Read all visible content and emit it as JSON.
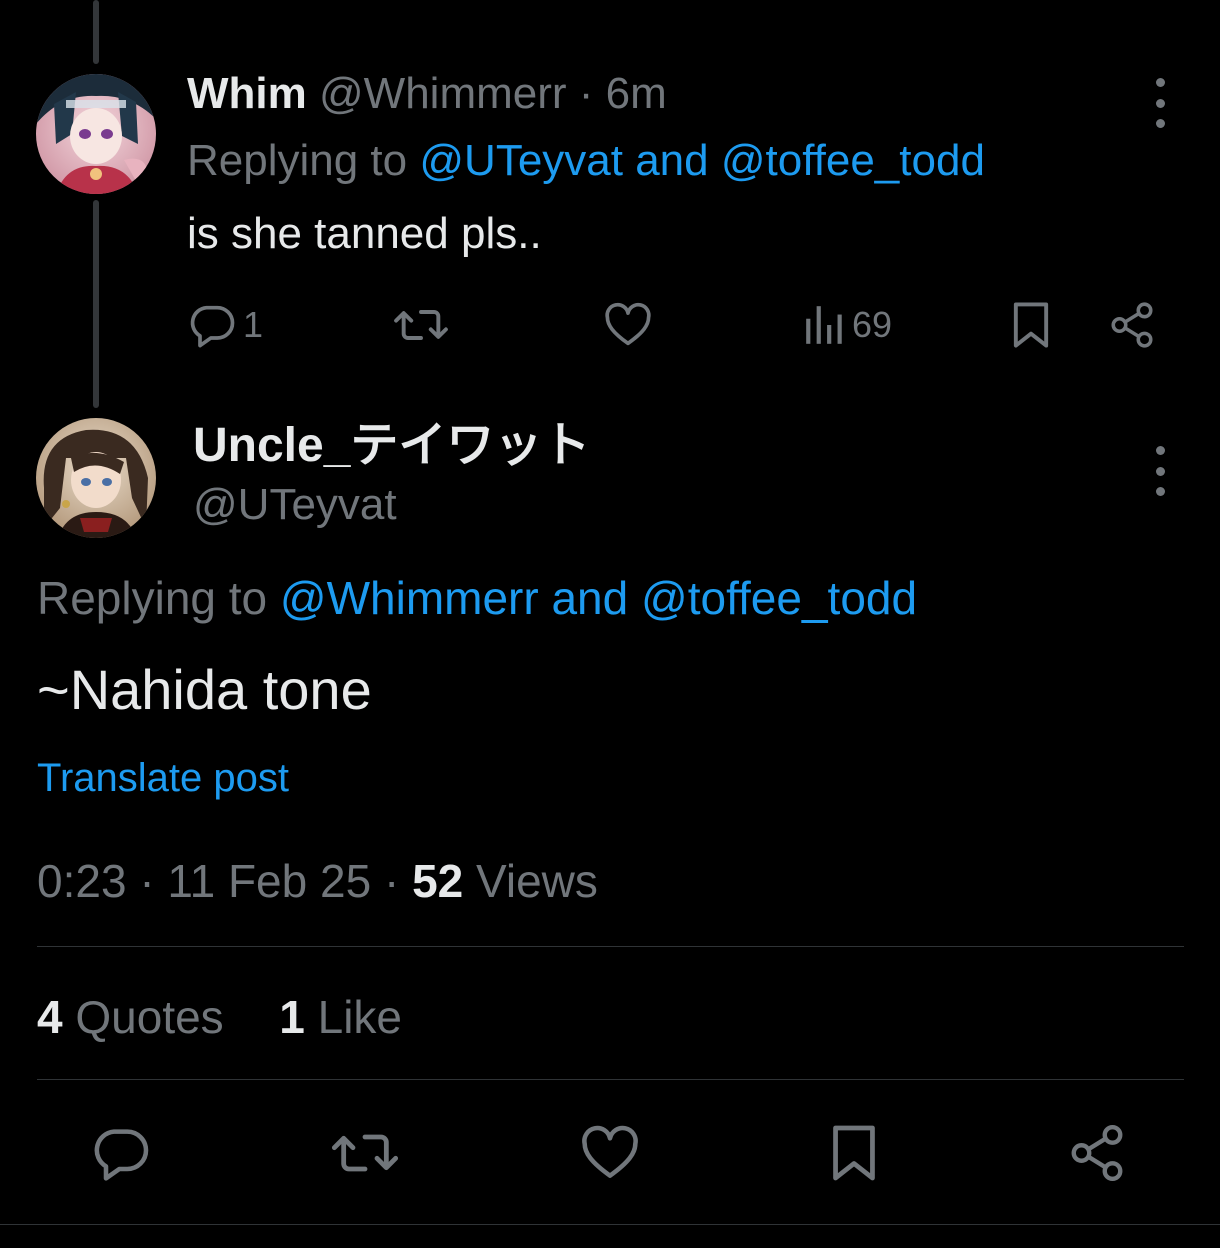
{
  "reply_tweet": {
    "author_name": "Whim",
    "author_handle": "@Whimmerr",
    "separator": "·",
    "time": "6m",
    "replying_prefix": "Replying to",
    "replying_to": "@UTeyvat and @toffee_todd",
    "text": "is she tanned pls..",
    "actions": {
      "reply_count": "1",
      "retweet_count": "",
      "like_count": "",
      "views_count": "69"
    }
  },
  "main_tweet": {
    "author_name": "Uncle_テイワット",
    "author_handle": "@UTeyvat",
    "replying_prefix": "Replying to",
    "replying_to": "@Whimmerr and @toffee_todd",
    "text": "~Nahida tone",
    "translate_label": "Translate post",
    "time": "0:23",
    "date": "11 Feb 25",
    "separator": "·",
    "views_count": "52",
    "views_label": "Views",
    "quotes_count": "4",
    "quotes_label": "Quotes",
    "likes_count": "1",
    "likes_label": "Like"
  },
  "colors": {
    "background": "#000000",
    "text_primary": "#e7e9ea",
    "text_secondary": "#71767b",
    "accent_blue": "#1d9bf0",
    "divider": "#2f3336"
  },
  "icons": {
    "reply": "reply-bubble-icon",
    "retweet": "retweet-icon",
    "like": "heart-icon",
    "views": "analytics-bars-icon",
    "bookmark": "bookmark-icon",
    "share": "share-icon",
    "more": "more-vertical-icon"
  }
}
